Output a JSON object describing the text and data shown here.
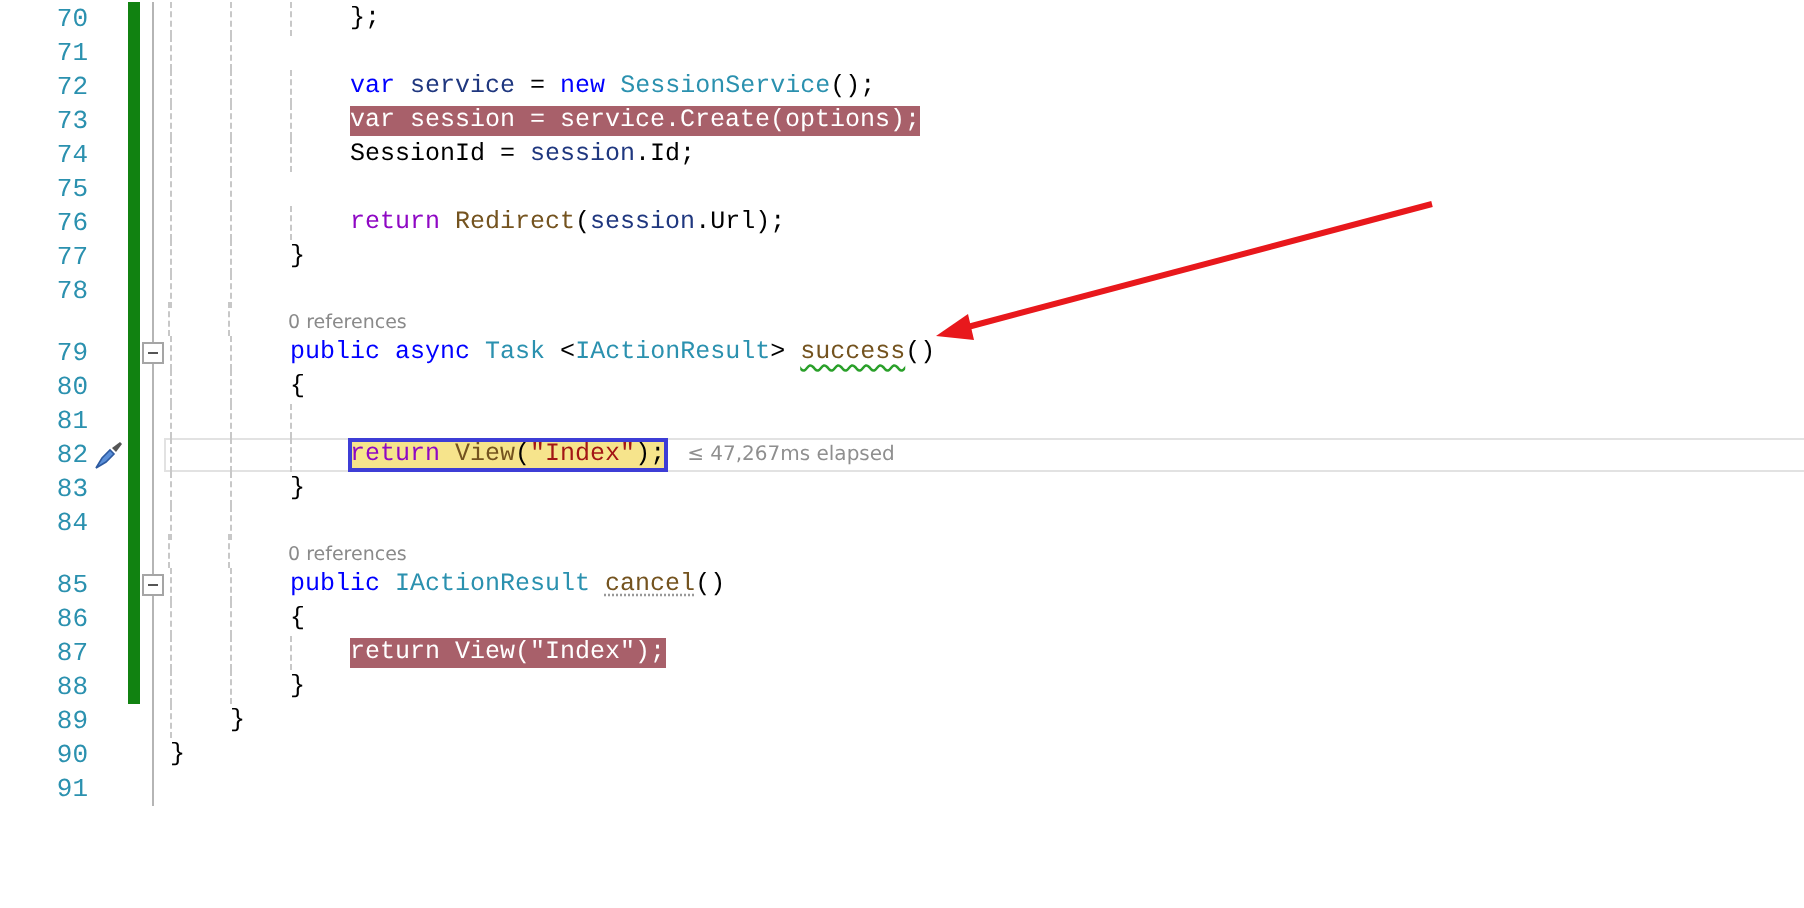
{
  "editor": {
    "blocks": [
      {
        "children": [
          {
            "children": [
              {
                "children": [
                  {
                    "number": "70",
                    "changed": true,
                    "collapsible": false,
                    "highlighted": false,
                    "current": false,
                    "tokens": [
                      {
                        "kind": "plain",
                        "text": "};"
                      }
                    ]
                  }
                ]
              },
              {
                "number": "71",
                "changed": true,
                "collapsible": false
              },
              {
                "children": [
                  {
                    "number": "72",
                    "changed": true,
                    "collapsible": false,
                    "highlighted": false,
                    "current": false,
                    "tokens": [
                      {
                        "kind": "keyword",
                        "text": "var"
                      },
                      {
                        "kind": "local",
                        "text": " service"
                      },
                      {
                        "kind": "plain",
                        "text": " = "
                      },
                      {
                        "kind": "keyword",
                        "text": "new"
                      },
                      {
                        "kind": "type",
                        "text": " SessionService"
                      },
                      {
                        "kind": "plain",
                        "text": "();"
                      }
                    ]
                  },
                  {
                    "number": "73",
                    "changed": true,
                    "collapsible": false,
                    "highlighted": true,
                    "current": false,
                    "tokens": [
                      {
                        "kind": "plain",
                        "text": "var session = service.Create(options);"
                      }
                    ]
                  },
                  {
                    "number": "74",
                    "changed": true,
                    "collapsible": false,
                    "highlighted": false,
                    "current": false,
                    "tokens": [
                      {
                        "kind": "plain",
                        "text": "SessionId = "
                      },
                      {
                        "kind": "local",
                        "text": "session"
                      },
                      {
                        "kind": "plain",
                        "text": ".Id;"
                      }
                    ]
                  }
                ]
              },
              {
                "number": "75",
                "changed": true,
                "collapsible": false
              },
              {
                "children": [
                  {
                    "number": "76",
                    "changed": true,
                    "collapsible": false,
                    "highlighted": false,
                    "current": false,
                    "tokens": [
                      {
                        "kind": "control",
                        "text": "return"
                      },
                      {
                        "kind": "method",
                        "text": " Redirect"
                      },
                      {
                        "kind": "plain",
                        "text": "("
                      },
                      {
                        "kind": "local",
                        "text": "session"
                      },
                      {
                        "kind": "plain",
                        "text": ".Url);"
                      }
                    ]
                  }
                ]
              },
              {
                "number": "77",
                "changed": true,
                "collapsible": false,
                "highlighted": false,
                "current": false,
                "tokens": [
                  {
                    "kind": "plain",
                    "text": "}"
                  }
                ]
              },
              {
                "number": "78",
                "changed": true,
                "collapsible": false
              },
              {
                "number": "79",
                "changed": true,
                "collapsible": true,
                "highlighted": false,
                "current": false,
                "codelens": "0 references",
                "tokens": [
                  {
                    "kind": "keyword",
                    "text": "public"
                  },
                  {
                    "kind": "keyword",
                    "text": " async"
                  },
                  {
                    "kind": "type",
                    "text": " Task"
                  },
                  {
                    "kind": "plain",
                    "text": " <"
                  },
                  {
                    "kind": "type",
                    "text": "IActionResult"
                  },
                  {
                    "kind": "plain",
                    "text": "> "
                  },
                  {
                    "kind": "method",
                    "text": "success",
                    "warning": true
                  },
                  {
                    "kind": "plain",
                    "text": "()"
                  }
                ]
              },
              {
                "number": "80",
                "changed": true,
                "collapsible": false,
                "highlighted": false,
                "current": false,
                "tokens": [
                  {
                    "kind": "plain",
                    "text": "{"
                  }
                ]
              },
              {
                "children": [
                  {
                    "number": "81",
                    "changed": true,
                    "collapsible": false
                  },
                  {
                    "number": "82",
                    "changed": true,
                    "collapsible": false,
                    "highlighted": false,
                    "current": true,
                    "hint": "≤ 47,267ms elapsed",
                    "tokens": [
                      {
                        "kind": "control",
                        "text": "return"
                      },
                      {
                        "kind": "method",
                        "text": " View"
                      },
                      {
                        "kind": "plain",
                        "text": "("
                      },
                      {
                        "kind": "string",
                        "text": "\"Index\""
                      },
                      {
                        "kind": "plain",
                        "text": ");"
                      }
                    ]
                  }
                ]
              },
              {
                "number": "83",
                "changed": true,
                "collapsible": false,
                "highlighted": false,
                "current": false,
                "tokens": [
                  {
                    "kind": "plain",
                    "text": "}"
                  }
                ]
              },
              {
                "number": "84",
                "changed": true,
                "collapsible": false
              },
              {
                "number": "85",
                "changed": true,
                "collapsible": true,
                "highlighted": false,
                "current": false,
                "codelens": "0 references",
                "tokens": [
                  {
                    "kind": "keyword",
                    "text": "public"
                  },
                  {
                    "kind": "type",
                    "text": " IActionResult "
                  },
                  {
                    "kind": "method",
                    "text": "cancel",
                    "suggestion": true
                  },
                  {
                    "kind": "plain",
                    "text": "()"
                  }
                ]
              },
              {
                "number": "86",
                "changed": true,
                "collapsible": false,
                "highlighted": false,
                "current": false,
                "tokens": [
                  {
                    "kind": "plain",
                    "text": "{"
                  }
                ]
              },
              {
                "children": [
                  {
                    "number": "87",
                    "changed": true,
                    "collapsible": false,
                    "highlighted": true,
                    "current": false,
                    "tokens": [
                      {
                        "kind": "plain",
                        "text": "return View(\"Index\");"
                      }
                    ]
                  }
                ]
              },
              {
                "number": "88",
                "changed": true,
                "collapsible": false,
                "highlighted": false,
                "current": false,
                "tokens": [
                  {
                    "kind": "plain",
                    "text": "}"
                  }
                ]
              }
            ]
          },
          {
            "number": "89",
            "changed": false,
            "collapsible": false,
            "highlighted": false,
            "current": false,
            "tokens": [
              {
                "kind": "plain",
                "text": "}"
              }
            ]
          }
        ]
      },
      {
        "number": "90",
        "changed": false,
        "collapsible": false,
        "highlighted": false,
        "current": false,
        "tokens": [
          {
            "kind": "plain",
            "text": "}"
          }
        ]
      },
      {
        "number": "91",
        "changed": false,
        "collapsible": false
      }
    ]
  }
}
